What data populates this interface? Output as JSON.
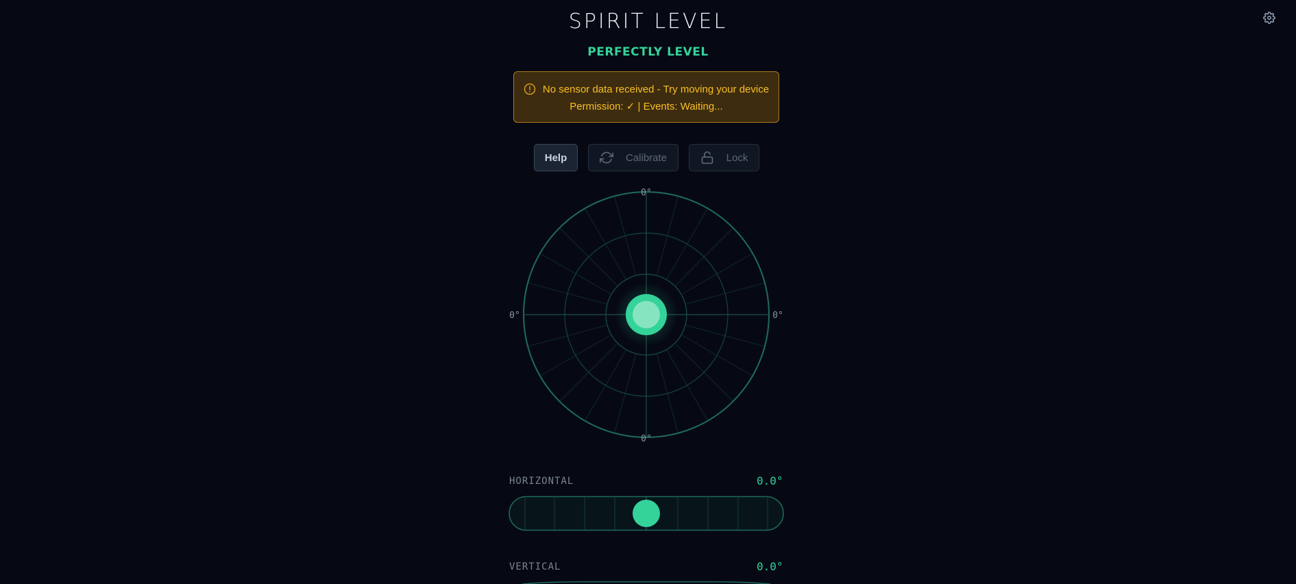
{
  "app": {
    "title": "SPIRIT LEVEL",
    "status": "PERFECTLY LEVEL"
  },
  "warning": {
    "message": "No sensor data received - Try moving your device",
    "detail": "Permission: ✓ | Events: Waiting..."
  },
  "toolbar": {
    "help_label": "Help",
    "calibrate_label": "Calibrate",
    "lock_label": "Lock"
  },
  "bubble_level": {
    "top_label": "0°",
    "bottom_label": "0°",
    "left_label": "0°",
    "right_label": "0°",
    "x_deg": 0.0,
    "y_deg": 0.0
  },
  "horizontal": {
    "label": "HORIZONTAL",
    "value": "0.0°",
    "tilt_deg": 0.0
  },
  "vertical": {
    "label": "VERTICAL",
    "value": "0.0°",
    "tilt_deg": 0.0
  },
  "colors": {
    "background": "#060914",
    "accent": "#34d399",
    "warning_bg": "#3d2c0f",
    "warning_border": "#b27a1b",
    "warning_text": "#fbbf24"
  },
  "icons": {
    "settings": "gear-icon",
    "warning": "alert-circle-icon",
    "calibrate": "refresh-icon",
    "lock": "unlock-icon"
  }
}
